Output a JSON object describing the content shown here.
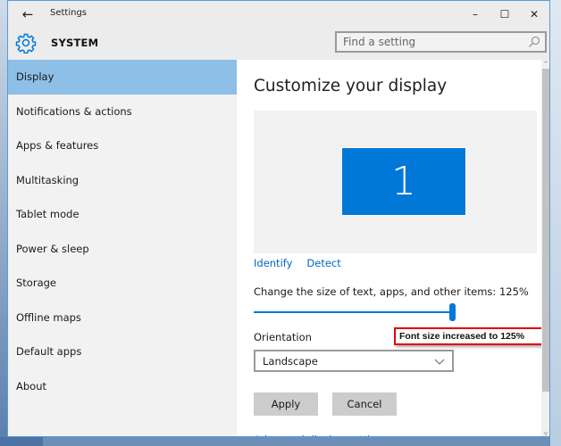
{
  "window": {
    "title": "Settings",
    "back_icon": "arrow-left-icon",
    "controls": {
      "minimize": "–",
      "maximize": "☐",
      "close": "✕"
    }
  },
  "header": {
    "icon": "gear-icon",
    "title": "SYSTEM",
    "search_placeholder": "Find a setting",
    "search_value": ""
  },
  "sidebar": {
    "items": [
      {
        "label": "Display",
        "active": true
      },
      {
        "label": "Notifications & actions",
        "active": false
      },
      {
        "label": "Apps & features",
        "active": false
      },
      {
        "label": "Multitasking",
        "active": false
      },
      {
        "label": "Tablet mode",
        "active": false
      },
      {
        "label": "Power & sleep",
        "active": false
      },
      {
        "label": "Storage",
        "active": false
      },
      {
        "label": "Offline maps",
        "active": false
      },
      {
        "label": "Default apps",
        "active": false
      },
      {
        "label": "About",
        "active": false
      }
    ]
  },
  "main": {
    "title": "Customize your display",
    "monitor_number": "1",
    "identify_label": "Identify",
    "detect_label": "Detect",
    "size_label": "Change the size of text, apps, and other items: 125%",
    "size_slider_value_percent": 125,
    "orientation_label": "Orientation",
    "orientation_value": "Landscape",
    "apply_label": "Apply",
    "cancel_label": "Cancel",
    "advanced_link": "Advanced display settings"
  },
  "annotation": {
    "text": "Font size increased to 125%",
    "border_color": "#e00000"
  },
  "colors": {
    "accent": "#0078d7",
    "selected_nav": "#8ebfe7",
    "link": "#0067c0"
  }
}
